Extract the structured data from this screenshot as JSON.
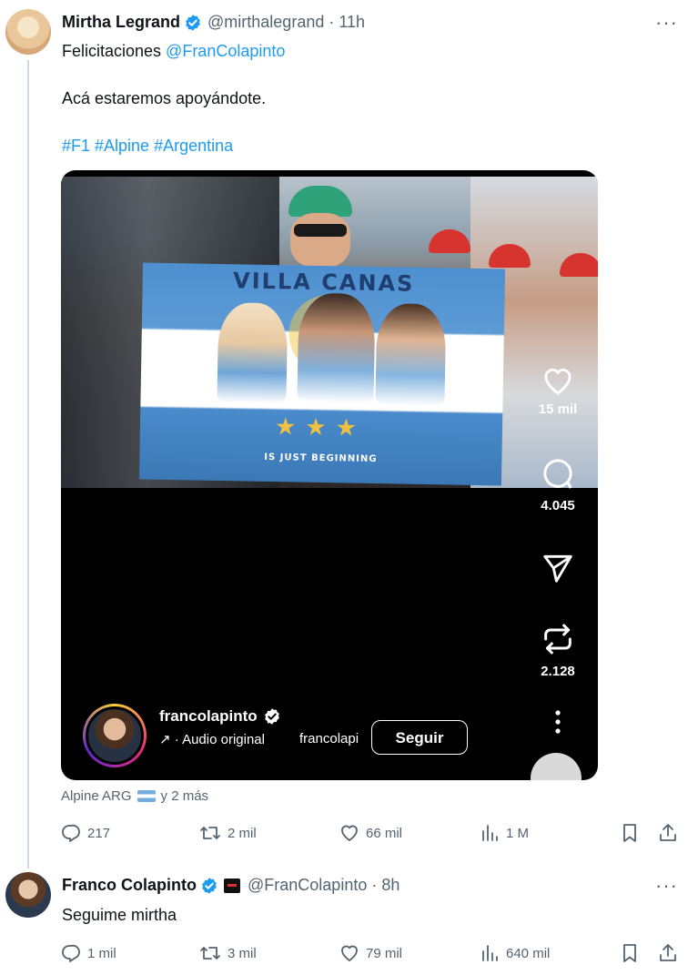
{
  "tweet1": {
    "name": "Mirtha Legrand",
    "handle": "@mirthalegrand",
    "separator": "·",
    "time": "11h",
    "more": "···",
    "line1_prefix": "Felicitaciones ",
    "line1_mention": "@FranColapinto",
    "line2": "Acá estaremos apoyándote.",
    "hashtags": "#F1 #Alpine #Argentina",
    "embed": {
      "banner_text": "VILLA CANAS",
      "banner_sub": "IS JUST BEGINNING",
      "stars": "★★★",
      "likes": "15 mil",
      "comments": "4.045",
      "reposts": "2.128",
      "username": "francolapinto",
      "audio_label": "↗ · Audio original",
      "audio_trunc": "francolapinto",
      "follow_label": "Seguir"
    },
    "social_context": {
      "before": "Alpine ARG",
      "after": "y 2 más"
    },
    "stats": {
      "replies": "217",
      "reposts": "2 mil",
      "likes": "66 mil",
      "views": "1 M"
    }
  },
  "tweet2": {
    "name": "Franco Colapinto",
    "handle": "@FranColapinto",
    "separator": "·",
    "time": "8h",
    "more": "···",
    "text": "Seguime mirtha",
    "stats": {
      "replies": "1 mil",
      "reposts": "3 mil",
      "likes": "79 mil",
      "views": "640 mil"
    }
  },
  "colors": {
    "link": "#1d9bf0",
    "muted": "#536471",
    "verified": "#1d9bf0"
  }
}
